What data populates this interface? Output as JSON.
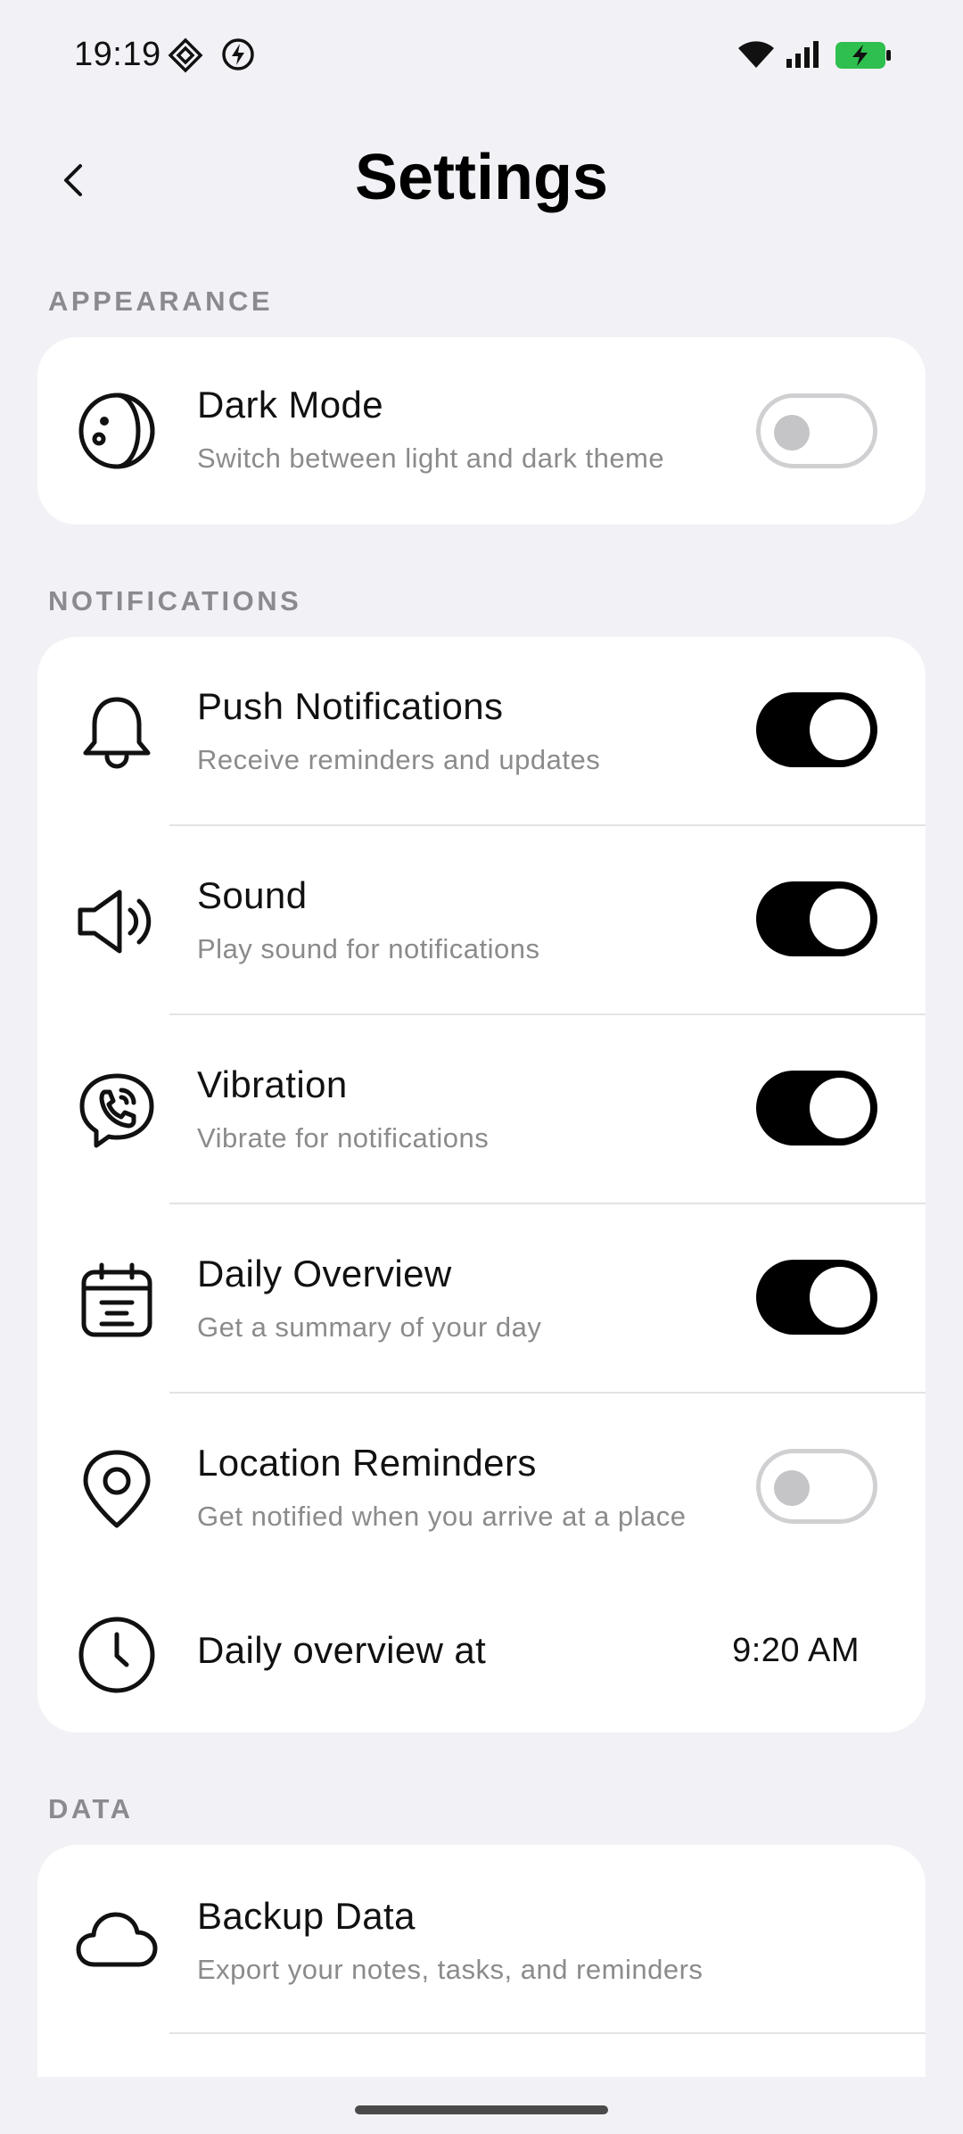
{
  "status_bar": {
    "time": "19:19"
  },
  "header": {
    "title": "Settings"
  },
  "sections": {
    "appearance": {
      "label": "APPEARANCE",
      "dark_mode": {
        "title": "Dark Mode",
        "subtitle": "Switch between light and dark theme",
        "enabled": false,
        "icon": "dark-mode-icon"
      }
    },
    "notifications": {
      "label": "NOTIFICATIONS",
      "push": {
        "title": "Push Notifications",
        "subtitle": "Receive reminders and updates",
        "enabled": true,
        "icon": "bell-icon"
      },
      "sound": {
        "title": "Sound",
        "subtitle": "Play sound for notifications",
        "enabled": true,
        "icon": "speaker-icon"
      },
      "vibration": {
        "title": "Vibration",
        "subtitle": "Vibrate for notifications",
        "enabled": true,
        "icon": "phone-vibrate-icon"
      },
      "daily_overview": {
        "title": "Daily Overview",
        "subtitle": "Get a summary of your day",
        "enabled": true,
        "icon": "calendar-icon"
      },
      "location": {
        "title": "Location Reminders",
        "subtitle": "Get notified when you arrive at a place",
        "enabled": false,
        "icon": "location-pin-icon"
      },
      "overview_time": {
        "title": "Daily overview at",
        "value": "9:20 AM",
        "icon": "clock-icon"
      }
    },
    "data": {
      "label": "DATA",
      "backup": {
        "title": "Backup Data",
        "subtitle": "Export your notes, tasks, and reminders",
        "icon": "cloud-icon"
      }
    }
  },
  "colors": {
    "background": "#f2f1f6",
    "card": "#ffffff",
    "toggle_on": "#000000",
    "toggle_off_border": "#d0d0d3",
    "battery": "#2fbf4f"
  }
}
